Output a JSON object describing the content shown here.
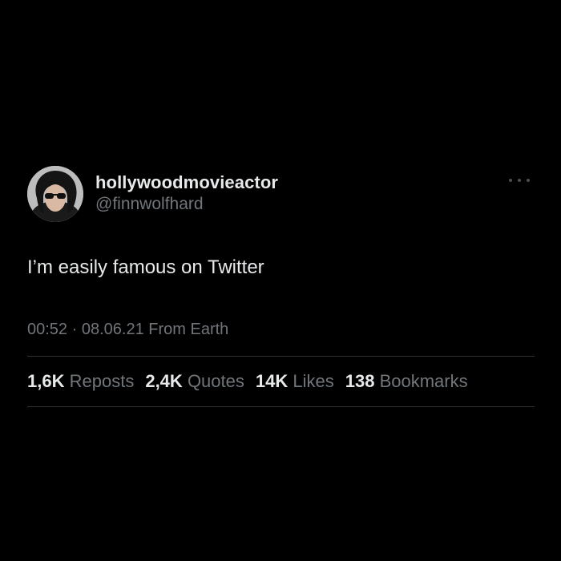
{
  "tweet": {
    "display_name": "hollywoodmovieactor",
    "handle": "@finnwolfhard",
    "avatar_icon": "profile-photo-avatar",
    "more_icon": "more-options-icon",
    "text": "I’m easily famous on Twitter",
    "time": "00:52",
    "separator": "·",
    "date": "08.06.21",
    "source": "From Earth"
  },
  "stats": [
    {
      "count": "1,6K",
      "label": "Reposts"
    },
    {
      "count": "2,4K",
      "label": "Quotes"
    },
    {
      "count": "14K",
      "label": "Likes"
    },
    {
      "count": "138",
      "label": "Bookmarks"
    }
  ],
  "colors": {
    "background": "#000000",
    "primary_text": "#e7e9ea",
    "secondary_text": "#71767b",
    "divider": "#2f3336"
  }
}
